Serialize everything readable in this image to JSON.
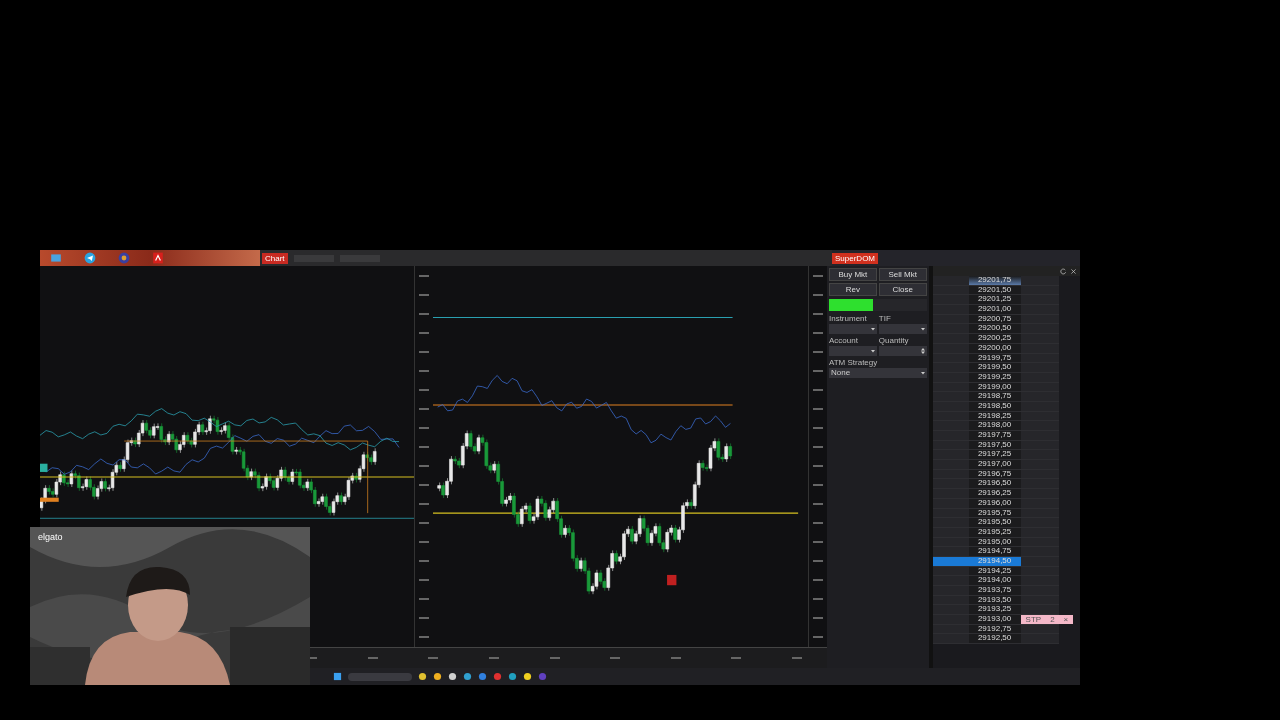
{
  "chart_toolbar": {
    "tab": "Chart"
  },
  "superdom": {
    "title": "SuperDOM",
    "buttons": [
      "Buy Mkt",
      "Sell Mkt",
      "Rev",
      "Close"
    ],
    "fields": [
      {
        "label": "Instrument",
        "kind": "select"
      },
      {
        "label": "TIF",
        "kind": "select"
      },
      {
        "label": "Account",
        "kind": "select"
      },
      {
        "label": "Quantity",
        "kind": "spinner"
      },
      {
        "label": "ATM Strategy",
        "kind": "select",
        "value": "None"
      }
    ]
  },
  "ladder": {
    "rows": [
      {
        "price": "29201,75",
        "selected": false
      },
      {
        "price": "29201,50",
        "selected": false
      },
      {
        "price": "29201,25",
        "selected": false
      },
      {
        "price": "29201,00",
        "selected": false
      },
      {
        "price": "29200,75",
        "selected": false
      },
      {
        "price": "29200,50",
        "selected": false
      },
      {
        "price": "29200,25",
        "selected": false
      },
      {
        "price": "29200,00",
        "selected": false
      },
      {
        "price": "29199,75",
        "selected": false
      },
      {
        "price": "29199,50",
        "selected": false
      },
      {
        "price": "29199,25",
        "selected": false
      },
      {
        "price": "29199,00",
        "selected": false
      },
      {
        "price": "29198,75",
        "selected": false
      },
      {
        "price": "29198,50",
        "selected": false
      },
      {
        "price": "29198,25",
        "selected": false
      },
      {
        "price": "29198,00",
        "selected": false
      },
      {
        "price": "29197,75",
        "selected": false
      },
      {
        "price": "29197,50",
        "selected": false
      },
      {
        "price": "29197,25",
        "selected": false
      },
      {
        "price": "29197,00",
        "selected": false
      },
      {
        "price": "29196,75",
        "selected": false
      },
      {
        "price": "29196,50",
        "selected": false
      },
      {
        "price": "29196,25",
        "selected": false
      },
      {
        "price": "29196,00",
        "selected": false
      },
      {
        "price": "29195,75",
        "selected": false
      },
      {
        "price": "29195,50",
        "selected": false
      },
      {
        "price": "29195,25",
        "selected": false
      },
      {
        "price": "29195,00",
        "selected": false
      },
      {
        "price": "29194,75",
        "selected": false
      },
      {
        "price": "29194,50",
        "selected": true
      },
      {
        "price": "29194,25",
        "selected": false
      },
      {
        "price": "29194,00",
        "selected": false
      },
      {
        "price": "29193,75",
        "selected": false
      },
      {
        "price": "29193,50",
        "selected": false
      },
      {
        "price": "29193,25",
        "selected": false
      },
      {
        "price": "29193,00",
        "selected": false,
        "order": {
          "type": "STP",
          "qty": "2",
          "close": "×"
        }
      },
      {
        "price": "29192,75",
        "selected": false
      },
      {
        "price": "29192,50",
        "selected": false
      }
    ]
  },
  "webcam": {
    "brand": "elgato"
  }
}
